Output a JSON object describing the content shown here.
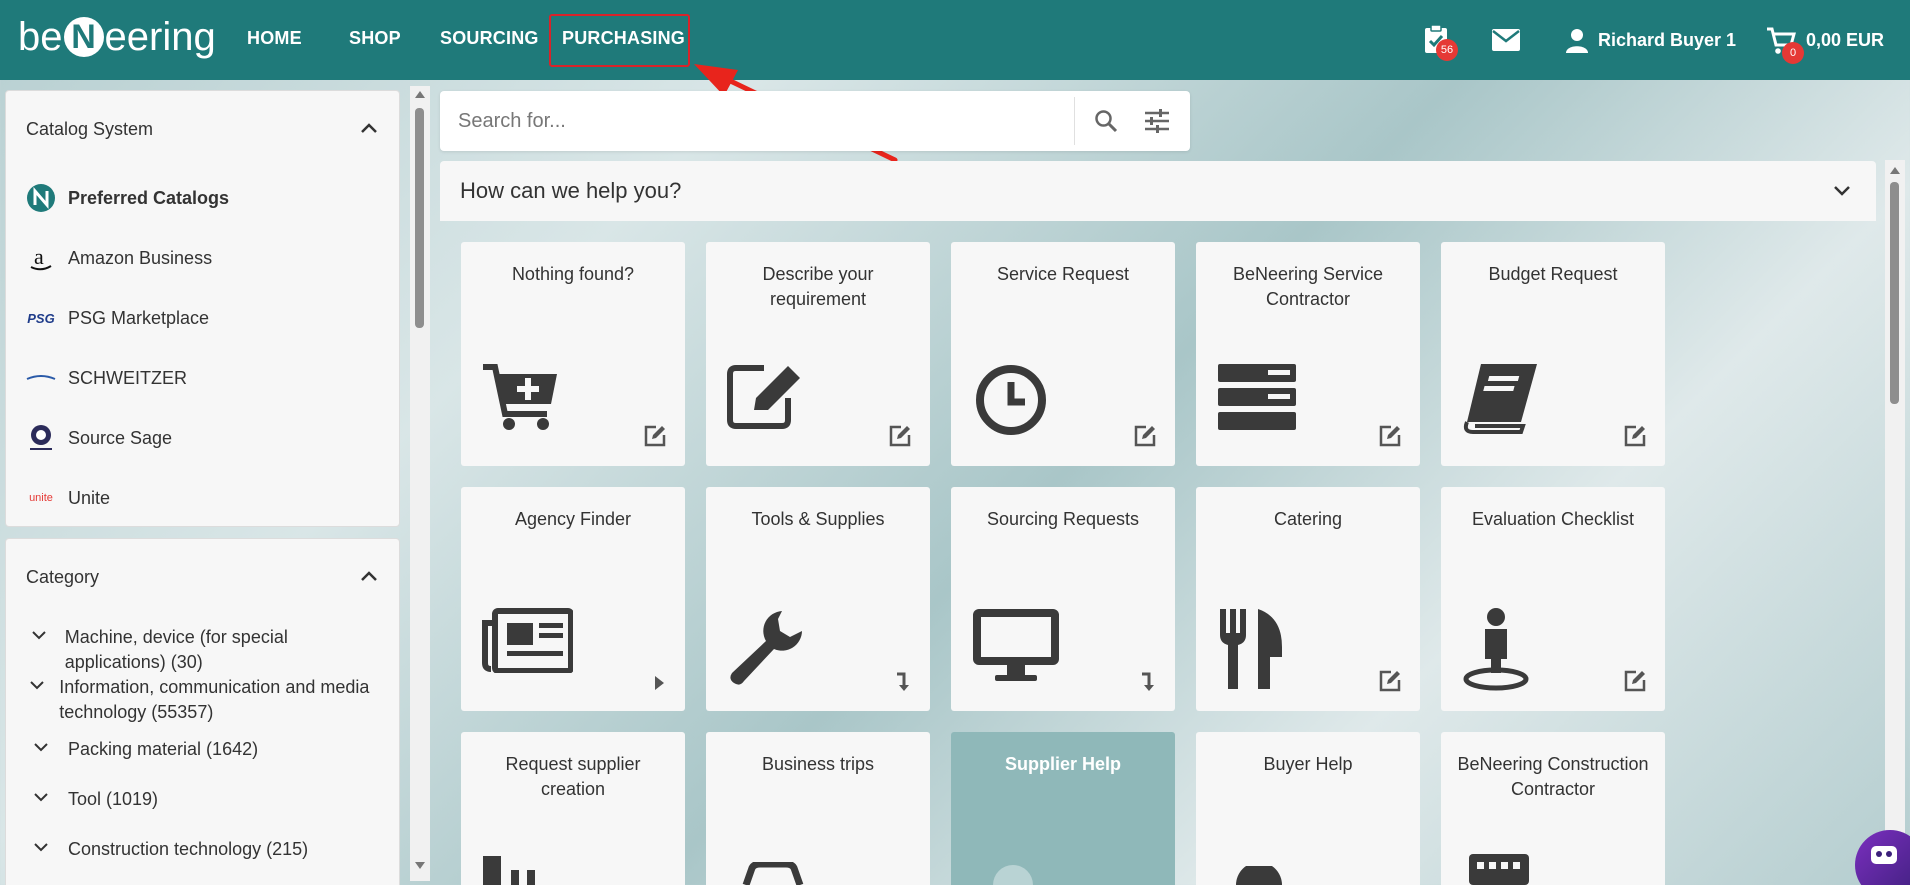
{
  "brand": {
    "logo_prefix": "be",
    "logo_n": "N",
    "logo_suffix": "eering"
  },
  "nav": {
    "items": [
      {
        "label": "HOME",
        "key": "home"
      },
      {
        "label": "SHOP",
        "key": "shop"
      },
      {
        "label": "SOURCING",
        "key": "sourcing"
      },
      {
        "label": "PURCHASING",
        "key": "purchasing"
      }
    ],
    "active": "PURCHASING",
    "tasks_badge": "56",
    "user_name": "Richard Buyer 1",
    "cart_badge": "0",
    "cart_total": "0,00 EUR"
  },
  "catalog_panel": {
    "title": "Catalog System",
    "items": [
      {
        "label": "Preferred Catalogs",
        "logo": "beneering-n-logo"
      },
      {
        "label": "Amazon Business",
        "logo": "amazon-logo"
      },
      {
        "label": "PSG Marketplace",
        "logo": "psg-logo",
        "logo_text": "PSG"
      },
      {
        "label": "SCHWEITZER",
        "logo": "schweitzer-logo"
      },
      {
        "label": "Source Sage",
        "logo": "source-sage-logo"
      },
      {
        "label": "Unite",
        "logo": "unite-logo",
        "logo_text": "unite"
      }
    ]
  },
  "category_panel": {
    "title": "Category",
    "items": [
      {
        "label": "Machine, device (for special applications) (30)"
      },
      {
        "label": "Information, communication and media technology (55357)"
      },
      {
        "label": "Packing material (1642)"
      },
      {
        "label": "Tool (1019)"
      },
      {
        "label": "Construction technology (215)"
      }
    ]
  },
  "search": {
    "placeholder": "Search for...",
    "value": ""
  },
  "help": {
    "title": "How can we help you?",
    "tiles": [
      {
        "title": "Nothing found?",
        "icon": "cart-plus-icon",
        "corner": "edit-icon"
      },
      {
        "title": "Describe your requirement",
        "icon": "pen-square-icon",
        "corner": "edit-icon"
      },
      {
        "title": "Service Request",
        "icon": "clock-icon",
        "corner": "edit-icon"
      },
      {
        "title": "BeNeering Service Contractor",
        "icon": "server-icon",
        "corner": "edit-icon"
      },
      {
        "title": "Budget Request",
        "icon": "book-icon",
        "corner": "edit-icon"
      },
      {
        "title": "Agency Finder",
        "icon": "newspaper-icon",
        "corner": "play-icon"
      },
      {
        "title": "Tools & Supplies",
        "icon": "wrench-icon",
        "corner": "return-icon"
      },
      {
        "title": "Sourcing Requests",
        "icon": "monitor-icon",
        "corner": "return-icon"
      },
      {
        "title": "Catering",
        "icon": "cutlery-icon",
        "corner": "edit-icon"
      },
      {
        "title": "Evaluation Checklist",
        "icon": "person-pin-icon",
        "corner": "edit-icon"
      },
      {
        "title": "Request supplier creation",
        "icon": "factory-icon",
        "corner": ""
      },
      {
        "title": "Business trips",
        "icon": "car-icon",
        "corner": ""
      },
      {
        "title": "Supplier Help",
        "icon": "question-icon",
        "corner": "",
        "highlight": true
      },
      {
        "title": "Buyer Help",
        "icon": "help-circle-icon",
        "corner": ""
      },
      {
        "title": "BeNeering Construction Contractor",
        "icon": "building-icon",
        "corner": ""
      }
    ]
  },
  "colors": {
    "nav_bg": "#1f7a7a",
    "accent_red": "#d9232a",
    "badge_red": "#e53935",
    "tile_highlight": "#8fb8b9"
  }
}
